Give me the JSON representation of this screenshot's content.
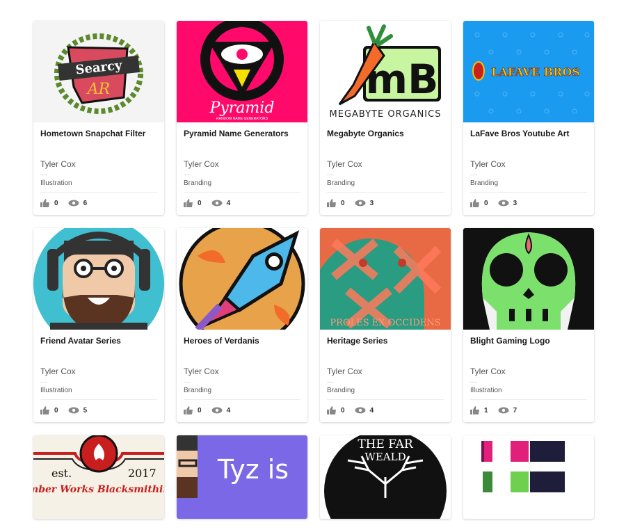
{
  "projects": [
    {
      "title": "Hometown Snapchat Filter",
      "author": "Tyler Cox",
      "category": "Illustration",
      "likes": "0",
      "views": "6",
      "thumb_text": "Searcy",
      "thumb_text2": "AR"
    },
    {
      "title": "Pyramid Name Generators",
      "author": "Tyler Cox",
      "category": "Branding",
      "likes": "0",
      "views": "4",
      "thumb_text": "Pyramid",
      "thumb_text2": "RANDOM NAME GENERATORS"
    },
    {
      "title": "Megabyte Organics",
      "author": "Tyler Cox",
      "category": "Branding",
      "likes": "0",
      "views": "3",
      "thumb_text": "MEGABYTE ORGANICS",
      "thumb_text2": "mB"
    },
    {
      "title": "LaFave Bros Youtube Art",
      "author": "Tyler Cox",
      "category": "Branding",
      "likes": "0",
      "views": "3",
      "thumb_text": "LAFAVE BROS"
    },
    {
      "title": "Friend Avatar Series",
      "author": "Tyler Cox",
      "category": "Illustration",
      "likes": "0",
      "views": "5"
    },
    {
      "title": "Heroes of Verdanis",
      "author": "Tyler Cox",
      "category": "Branding",
      "likes": "0",
      "views": "4"
    },
    {
      "title": "Heritage Series",
      "author": "Tyler Cox",
      "category": "Branding",
      "likes": "0",
      "views": "4",
      "thumb_text": "PROLES EX OCCIDENS"
    },
    {
      "title": "Blight Gaming Logo",
      "author": "Tyler Cox",
      "category": "Illustration",
      "likes": "1",
      "views": "7"
    }
  ],
  "partial_row": [
    {
      "thumb_text": "Ember Works Blacksmithing",
      "thumb_text2": "est.",
      "thumb_text3": "2017"
    },
    {
      "thumb_text": "Tyz is"
    },
    {
      "thumb_text": "THE FAR",
      "thumb_text2": "WEALD"
    },
    {}
  ],
  "colors": {
    "accent_pink": "#ff0a6a",
    "lafave_blue": "#1b9bef",
    "megabyte_green": "#c7f5a0",
    "blight_green": "#7ce06c"
  },
  "icons": {
    "like": "thumbs-up-icon",
    "view": "eye-icon"
  }
}
